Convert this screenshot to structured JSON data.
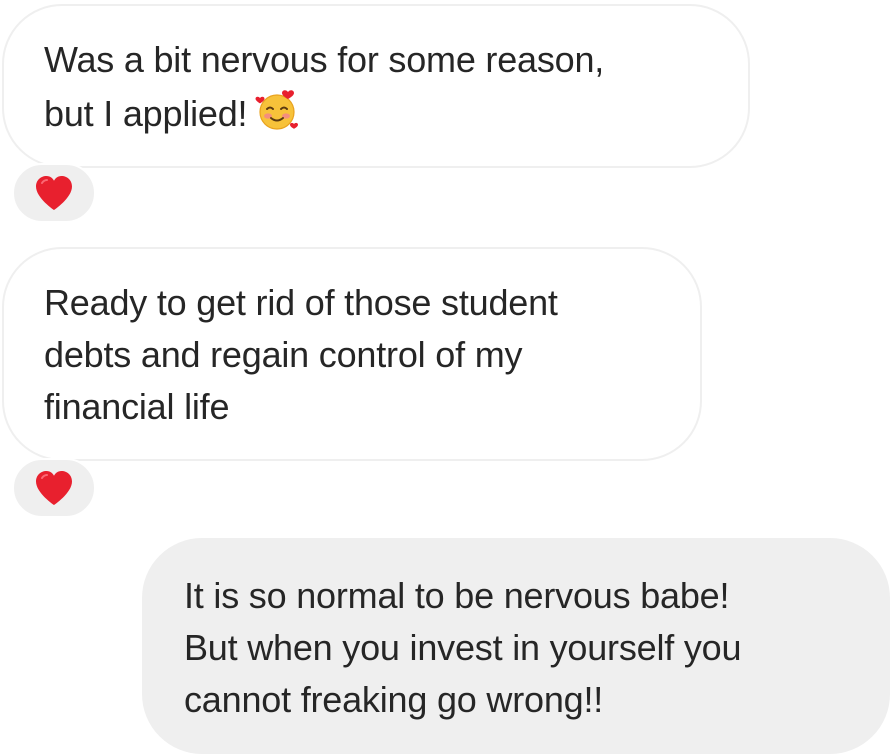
{
  "messages": [
    {
      "direction": "incoming",
      "lines": [
        "Was a bit nervous for some reason,",
        "but I applied!"
      ],
      "emoji": "smiling-face-with-hearts-icon",
      "reaction": "red-heart-icon"
    },
    {
      "direction": "incoming",
      "lines": [
        "Ready to get rid of those student",
        "debts and regain control of my",
        "financial life"
      ],
      "reaction": "red-heart-icon"
    },
    {
      "direction": "outgoing",
      "lines": [
        "It is so normal to be nervous babe!",
        "But when you invest in yourself you",
        "cannot freaking go wrong!!"
      ]
    }
  ],
  "colors": {
    "incoming_bubble_bg": "#ffffff",
    "incoming_bubble_border": "#efefef",
    "outgoing_bubble_bg": "#efefef",
    "text": "#262626",
    "heart": "#e8202e"
  }
}
